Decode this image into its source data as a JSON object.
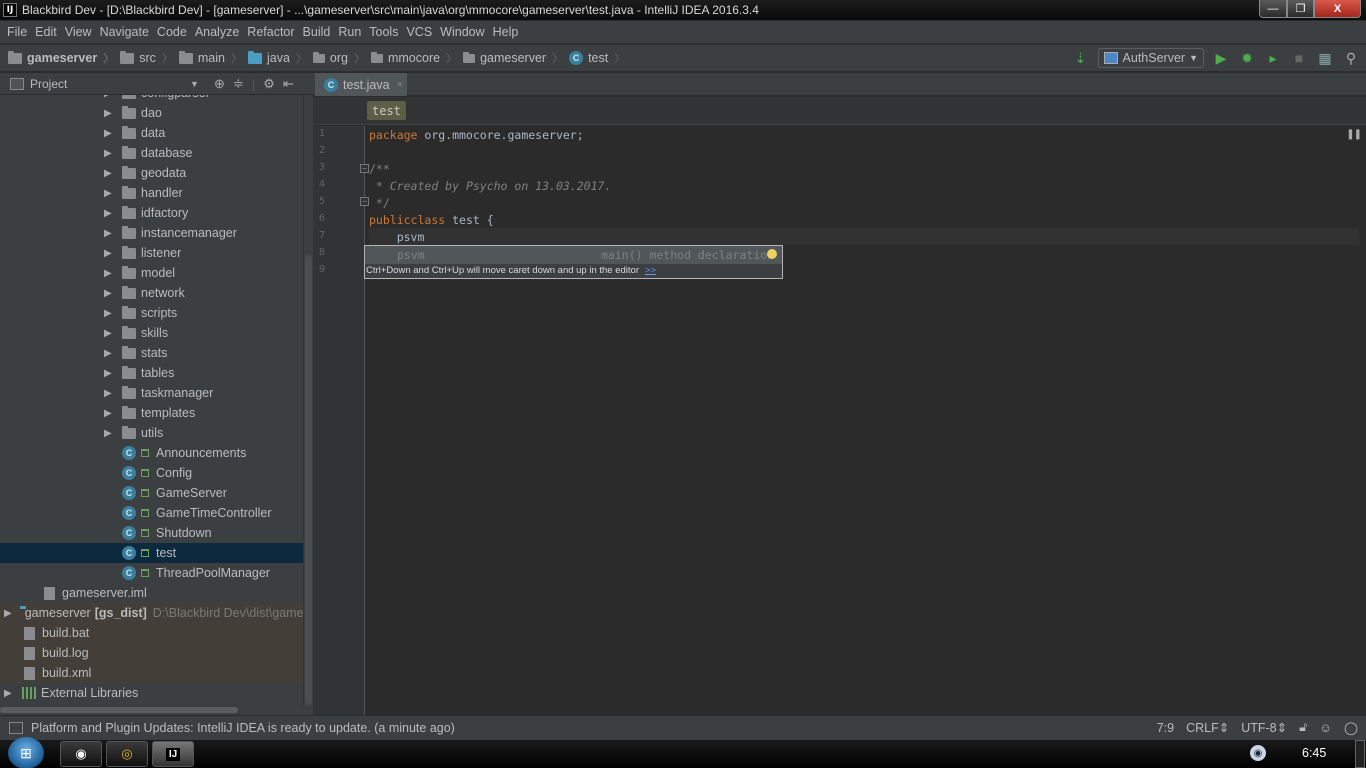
{
  "window": {
    "app_icon": "IJ",
    "title": "Blackbird Dev - [D:\\Blackbird Dev] - [gameserver] - ...\\gameserver\\src\\main\\java\\org\\mmocore\\gameserver\\test.java - IntelliJ IDEA 2016.3.4",
    "controls": {
      "minimize": "—",
      "maximize": "❐",
      "close": "X"
    }
  },
  "menu": [
    "File",
    "Edit",
    "View",
    "Navigate",
    "Code",
    "Analyze",
    "Refactor",
    "Build",
    "Run",
    "Tools",
    "VCS",
    "Window",
    "Help"
  ],
  "navbar": {
    "breadcrumbs": [
      {
        "label": "gameserver",
        "icon": "module-folder-icon"
      },
      {
        "label": "src",
        "icon": "folder-icon"
      },
      {
        "label": "main",
        "icon": "folder-icon"
      },
      {
        "label": "java",
        "icon": "source-folder-icon"
      },
      {
        "label": "org",
        "icon": "package-icon"
      },
      {
        "label": "mmocore",
        "icon": "package-icon"
      },
      {
        "label": "gameserver",
        "icon": "package-icon"
      },
      {
        "label": "test",
        "icon": "class-icon"
      }
    ],
    "run_config": "AuthServer",
    "toolbar_icons": [
      "make-icon",
      "run-icon",
      "debug-icon",
      "coverage-icon",
      "stop-icon",
      "project-structure-icon",
      "search-icon"
    ]
  },
  "project_panel": {
    "title": "Project",
    "tools": [
      "locate-icon",
      "collapse-icon",
      "gear-icon",
      "hide-icon"
    ],
    "items": [
      {
        "label": "configparser",
        "type": "folder",
        "expandable": true
      },
      {
        "label": "dao",
        "type": "folder",
        "expandable": true
      },
      {
        "label": "data",
        "type": "folder",
        "expandable": true
      },
      {
        "label": "database",
        "type": "folder",
        "expandable": true
      },
      {
        "label": "geodata",
        "type": "folder",
        "expandable": true
      },
      {
        "label": "handler",
        "type": "folder",
        "expandable": true
      },
      {
        "label": "idfactory",
        "type": "folder",
        "expandable": true
      },
      {
        "label": "instancemanager",
        "type": "folder",
        "expandable": true
      },
      {
        "label": "listener",
        "type": "folder",
        "expandable": true
      },
      {
        "label": "model",
        "type": "folder",
        "expandable": true
      },
      {
        "label": "network",
        "type": "folder",
        "expandable": true
      },
      {
        "label": "scripts",
        "type": "folder",
        "expandable": true
      },
      {
        "label": "skills",
        "type": "folder",
        "expandable": true
      },
      {
        "label": "stats",
        "type": "folder",
        "expandable": true
      },
      {
        "label": "tables",
        "type": "folder",
        "expandable": true
      },
      {
        "label": "taskmanager",
        "type": "folder",
        "expandable": true
      },
      {
        "label": "templates",
        "type": "folder",
        "expandable": true
      },
      {
        "label": "utils",
        "type": "folder",
        "expandable": true
      },
      {
        "label": "Announcements",
        "type": "class"
      },
      {
        "label": "Config",
        "type": "class"
      },
      {
        "label": "GameServer",
        "type": "class"
      },
      {
        "label": "GameTimeController",
        "type": "class"
      },
      {
        "label": "Shutdown",
        "type": "class"
      },
      {
        "label": "test",
        "type": "class",
        "selected": true
      },
      {
        "label": "ThreadPoolManager",
        "type": "class"
      }
    ],
    "root_items": [
      {
        "label": "gameserver.iml",
        "type": "iml"
      },
      {
        "label": "gameserver",
        "bold_suffix": "[gs_dist]",
        "path": "D:\\Blackbird Dev\\dist\\gamese",
        "type": "module",
        "expandable": true
      },
      {
        "label": "build.bat",
        "type": "file"
      },
      {
        "label": "build.log",
        "type": "file"
      },
      {
        "label": "build.xml",
        "type": "file"
      },
      {
        "label": "External Libraries",
        "type": "library",
        "expandable": true
      }
    ]
  },
  "editor": {
    "tab": {
      "label": "test.java",
      "close": "×"
    },
    "code_breadcrumb": "test",
    "line_numbers": [
      "1",
      "2",
      "3",
      "4",
      "5",
      "6",
      "7",
      "8",
      "9"
    ],
    "lines": {
      "l1_kw": "package",
      "l1_rest": " org.mmocore.gameserver;",
      "l3": "/**",
      "l4_star": " * ",
      "l4_text": "Created by Psycho on 13.03.2017.",
      "l5": " */",
      "l6_kw1": "public",
      "l6_kw2": "class",
      "l6_rest": " test {",
      "l7": "    psvm"
    },
    "completion": {
      "abbreviation": "psvm",
      "description": "main() method declaration",
      "hint": "Ctrl+Down and Ctrl+Up will move caret down and up in the editor",
      "hint_link": ">>"
    }
  },
  "statusbar": {
    "message": "Platform and Plugin Updates: IntelliJ IDEA is ready to update. (a minute ago)",
    "caret": "7:9",
    "line_separator": "CRLF",
    "encoding": "UTF-8"
  },
  "taskbar": {
    "apps": [
      "steam-icon",
      "chrome-icon",
      "intellij-icon"
    ],
    "intellij_label": "IJ",
    "clock": "6:45"
  }
}
